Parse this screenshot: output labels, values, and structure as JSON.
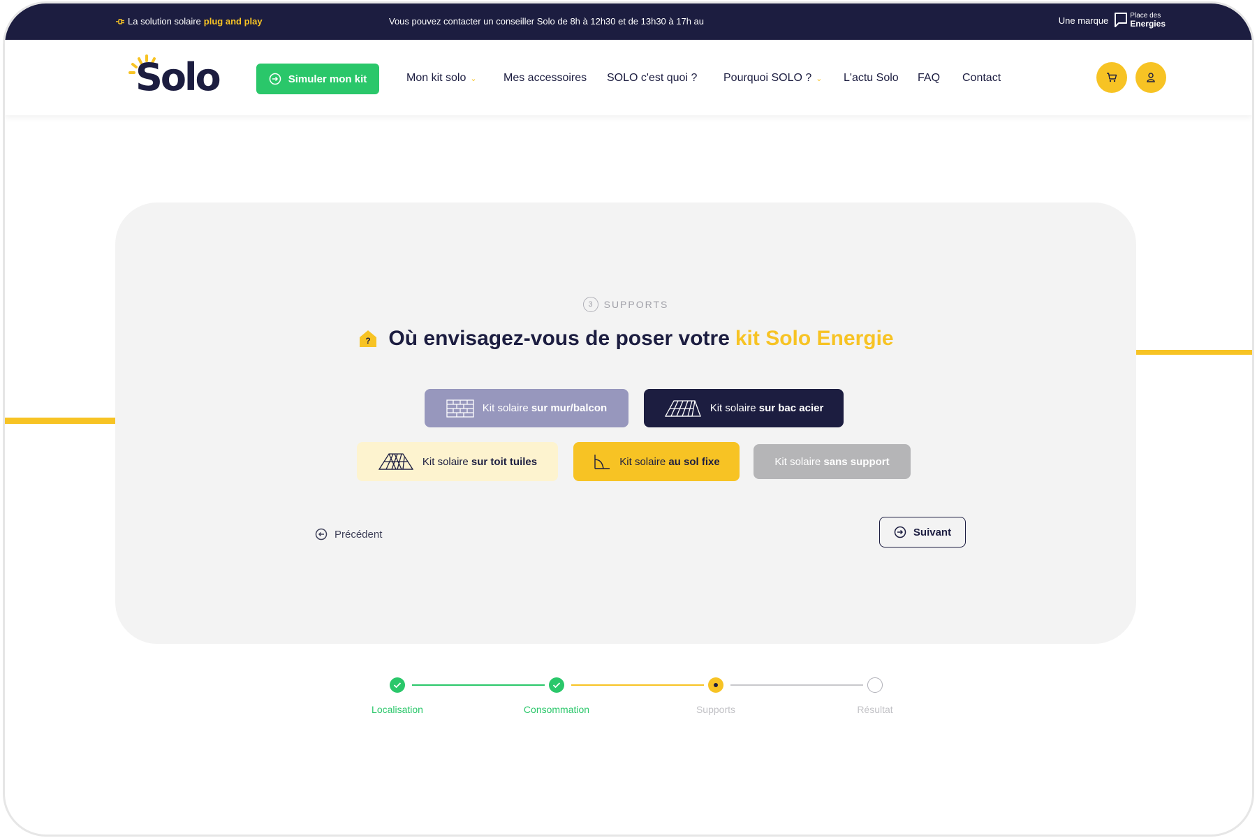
{
  "topbar": {
    "tagline_prefix": "La solution solaire",
    "tagline_highlight": "plug and play",
    "contact_text": "Vous pouvez contacter un conseiller Solo de 8h à 12h30 et de 13h30 à 17h au",
    "brand_prefix": "Une marque",
    "brand_line1": "Place des",
    "brand_line2": "Energies"
  },
  "header": {
    "logo_text": "Solo",
    "cta_label": "Simuler mon kit",
    "nav": [
      {
        "label": "Mon kit solo",
        "has_dropdown": true
      },
      {
        "label": "Mes accessoires",
        "has_dropdown": false
      },
      {
        "label": "SOLO c'est quoi ?",
        "has_dropdown": false
      },
      {
        "label": "Pourquoi SOLO ?",
        "has_dropdown": true
      },
      {
        "label": "L'actu Solo",
        "has_dropdown": false
      },
      {
        "label": "FAQ",
        "has_dropdown": false
      },
      {
        "label": "Contact",
        "has_dropdown": false
      }
    ],
    "cart_icon": "cart-icon",
    "account_icon": "user-icon"
  },
  "step": {
    "number": "3",
    "label": "SUPPORTS",
    "question_prefix": "Où envisagez-vous de poser votre",
    "question_accent": "kit Solo Energie"
  },
  "options": [
    {
      "prefix": "Kit solaire",
      "bold": "sur mur/balcon",
      "icon": "brick-wall-icon",
      "state": "hover"
    },
    {
      "prefix": "Kit solaire",
      "bold": "sur bac acier",
      "icon": "steel-roof-icon",
      "state": "selected-dark"
    },
    {
      "prefix": "Kit solaire",
      "bold": "sur toit tuiles",
      "icon": "tile-roof-icon",
      "state": "light"
    },
    {
      "prefix": "Kit solaire",
      "bold": "au sol fixe",
      "icon": "ground-mount-icon",
      "state": "active"
    },
    {
      "prefix": "Kit solaire",
      "bold": "sans support",
      "icon": "",
      "state": "disabled"
    }
  ],
  "navigation": {
    "prev_label": "Précédent",
    "next_label": "Suivant"
  },
  "progress": [
    {
      "label": "Localisation",
      "status": "done"
    },
    {
      "label": "Consommation",
      "status": "done"
    },
    {
      "label": "Supports",
      "status": "current"
    },
    {
      "label": "Résultat",
      "status": "todo"
    }
  ],
  "colors": {
    "navy": "#1c1d40",
    "yellow": "#f7c324",
    "green": "#2ac76a",
    "card_bg": "#f3f3f3"
  }
}
